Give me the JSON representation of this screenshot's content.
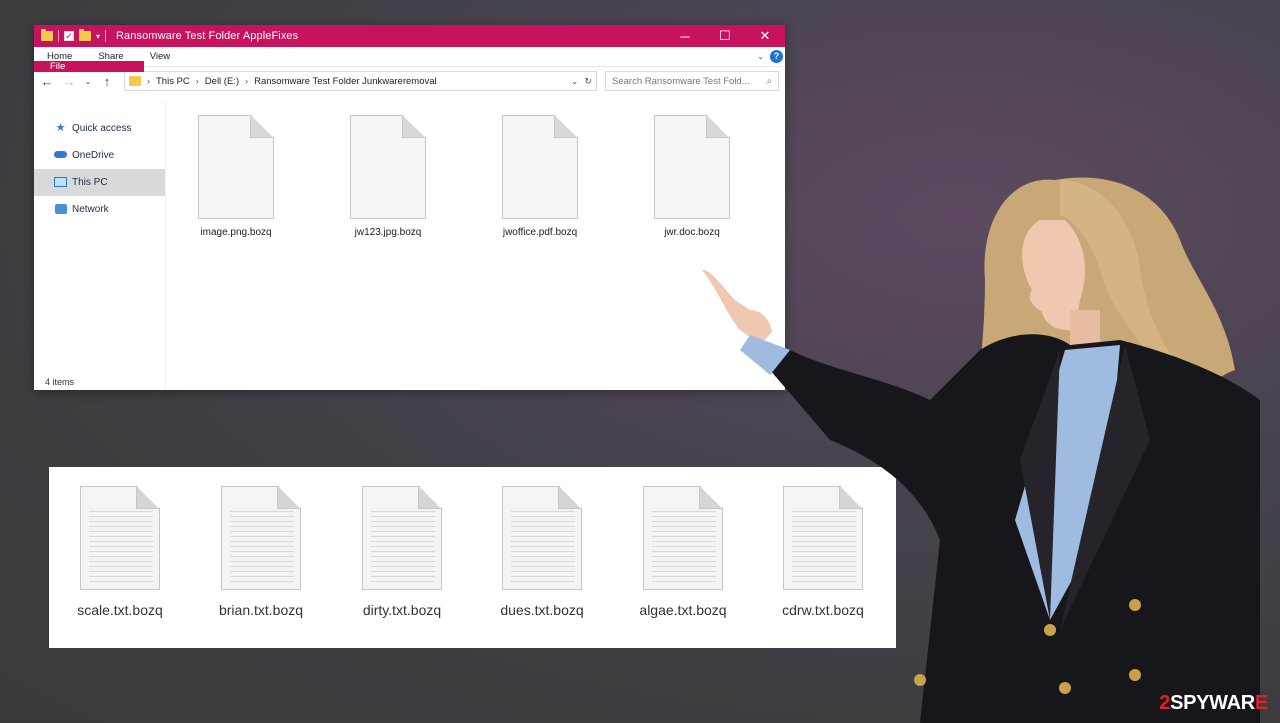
{
  "window": {
    "title": "Ransomware Test Folder AppleFixes",
    "controls": {
      "minimize": "─",
      "maximize": "☐",
      "close": "✕"
    }
  },
  "ribbon": {
    "tabs": [
      "File",
      "Home",
      "Share",
      "View"
    ],
    "help": "?"
  },
  "address": {
    "crumbs": [
      "This PC",
      "Dell (E:)",
      "Ransomware Test Folder Junkwareremoval"
    ],
    "search_placeholder": "Search Ransomware Test Fold..."
  },
  "nav_pane": {
    "items": [
      {
        "label": "Quick access",
        "icon": "star-icon"
      },
      {
        "label": "OneDrive",
        "icon": "cloud-icon"
      },
      {
        "label": "This PC",
        "icon": "monitor-icon",
        "selected": true
      },
      {
        "label": "Network",
        "icon": "network-icon"
      }
    ]
  },
  "files": [
    "image.png.bozq",
    "jw123.jpg.bozq",
    "jwoffice.pdf.bozq",
    "jwr.doc.bozq"
  ],
  "status": "4 items",
  "text_files": [
    "scale.txt.bozq",
    "brian.txt.bozq",
    "dirty.txt.bozq",
    "dues.txt.bozq",
    "algae.txt.bozq",
    "cdrw.txt.bozq"
  ],
  "watermark": {
    "prefix": "2",
    "brand": "SPYWAR",
    "suffix": "E"
  },
  "colors": {
    "accent": "#c7135d",
    "link_blue": "#2f79d6",
    "watermark_red": "#e21f2a"
  }
}
